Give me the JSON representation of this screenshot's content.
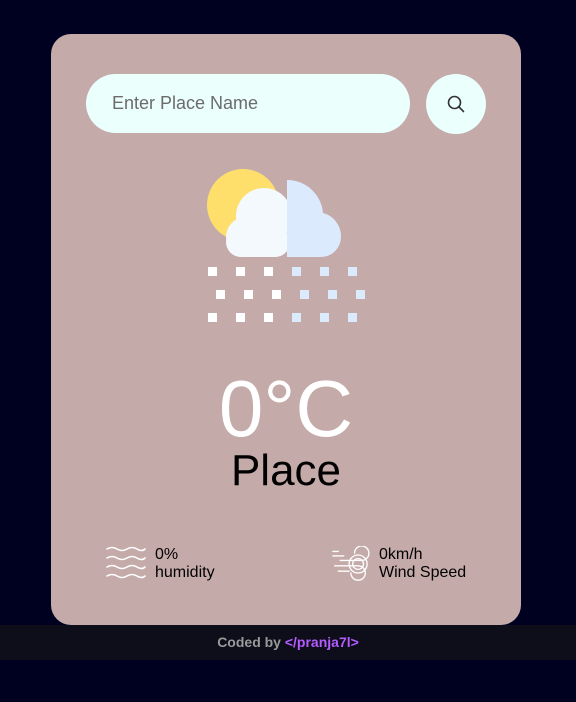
{
  "search": {
    "placeholder": "Enter Place Name",
    "button_icon": "search-icon"
  },
  "weather": {
    "icon": "snow-cloud-sun-icon",
    "temperature": "0°C",
    "place": "Place"
  },
  "stats": {
    "humidity": {
      "icon": "humidity-waves-icon",
      "value": "0%",
      "label": "humidity"
    },
    "wind": {
      "icon": "wind-icon",
      "value": "0km/h",
      "label": "Wind Speed"
    }
  },
  "footer": {
    "prefix": "Coded by",
    "link": "</pranja7l>"
  },
  "colors": {
    "background": "#000020",
    "card": "#c4aaa9",
    "input": "#ebfffc",
    "link": "#b35bff",
    "sun": "#fedf6c"
  }
}
